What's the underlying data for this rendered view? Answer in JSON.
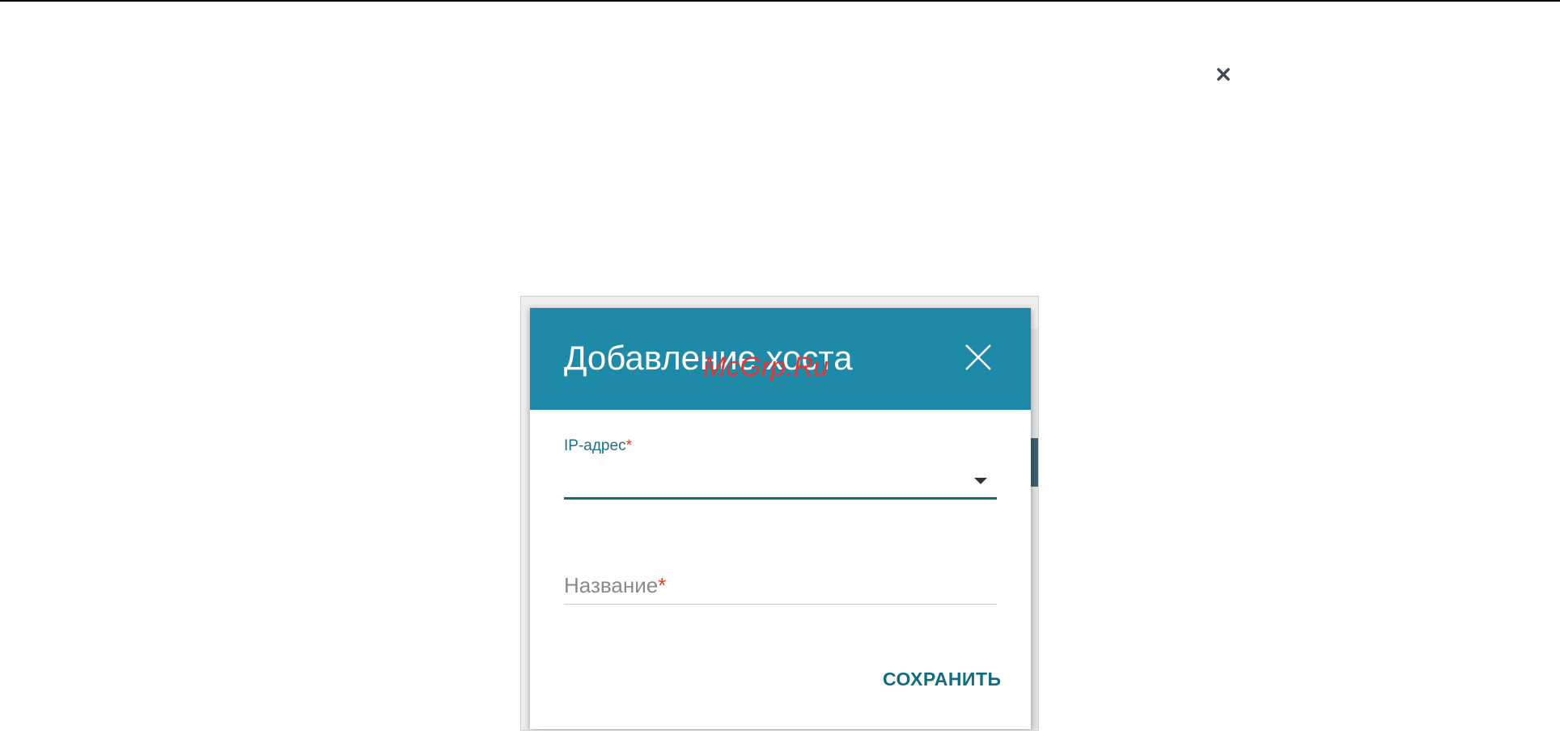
{
  "page": {
    "close_icon": "close-icon"
  },
  "dialog": {
    "title": "Добавление хоста",
    "close_icon": "close-icon",
    "header_color": "#1f8aa8",
    "watermark": "McGrp.Ru",
    "ip_field": {
      "label": "IP-адрес",
      "required_mark": "*",
      "value": ""
    },
    "name_field": {
      "placeholder": "Название",
      "required_mark": "*",
      "value": ""
    },
    "save_label": "СОХРАНИТЬ"
  }
}
